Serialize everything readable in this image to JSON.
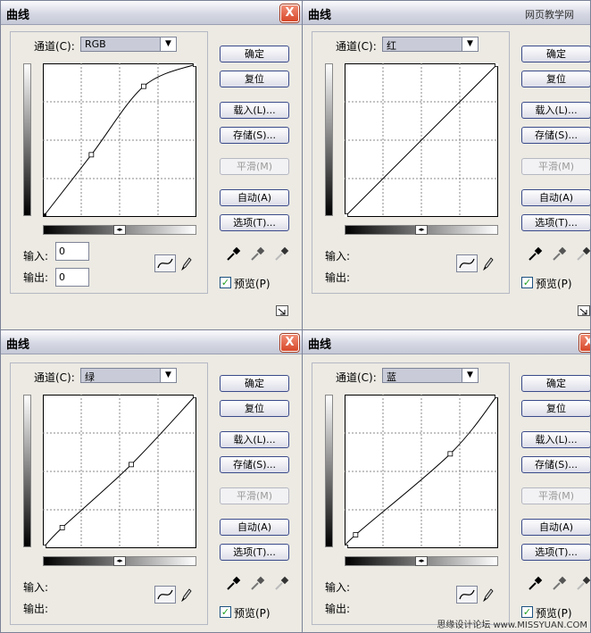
{
  "dialogs": [
    {
      "title": "曲线",
      "channel": "RGB",
      "input_value": "0",
      "output_value": "0"
    },
    {
      "title": "曲线",
      "channel": "红",
      "input_value": "",
      "output_value": ""
    },
    {
      "title": "曲线",
      "channel": "绿",
      "input_value": "",
      "output_value": ""
    },
    {
      "title": "曲线",
      "channel": "蓝",
      "input_value": "",
      "output_value": ""
    }
  ],
  "labels": {
    "channel": "通道(C):",
    "input": "输入:",
    "output": "输出:",
    "ok": "确定",
    "reset": "复位",
    "load": "载入(L)...",
    "save": "存储(S)...",
    "smooth": "平滑(M)",
    "auto": "自动(A)",
    "options": "选项(T)...",
    "preview": "预览(P)",
    "close": "X"
  },
  "watermark_top": "网页教学网",
  "watermark_bottom": "思缘设计论坛 www.MISSYUAN.COM",
  "icons": {
    "curve": "curve-tool-icon",
    "pencil": "pencil-tool-icon",
    "black_dropper": "black-eyedropper-icon",
    "gray_dropper": "gray-eyedropper-icon",
    "white_dropper": "white-eyedropper-icon",
    "resize": "resize-grip-icon"
  },
  "curves": [
    {
      "channel": "RGB",
      "points": [
        [
          0,
          0
        ],
        [
          80,
          103
        ],
        [
          168,
          218
        ],
        [
          255,
          255
        ]
      ]
    },
    {
      "channel": "红",
      "points": [
        [
          0,
          0
        ],
        [
          255,
          255
        ]
      ]
    },
    {
      "channel": "绿",
      "points": [
        [
          0,
          0
        ],
        [
          31,
          33
        ],
        [
          147,
          139
        ],
        [
          255,
          255
        ]
      ]
    },
    {
      "channel": "蓝",
      "points": [
        [
          0,
          0
        ],
        [
          17,
          21
        ],
        [
          176,
          157
        ],
        [
          255,
          255
        ]
      ]
    }
  ]
}
